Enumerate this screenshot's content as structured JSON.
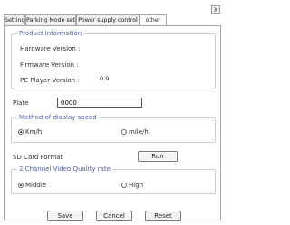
{
  "window": {
    "close_label": "X"
  },
  "tabs": [
    {
      "label": "Setting",
      "active": false
    },
    {
      "label": "Parking Mode set",
      "active": false
    },
    {
      "label": "Power supply control",
      "active": false
    },
    {
      "label": "other",
      "active": true
    }
  ],
  "product_info": {
    "title": "Product information",
    "hardware_label": "Hardware Version :",
    "hardware_value": "",
    "firmware_label": "Firmware Version :",
    "firmware_value": "",
    "pc_player_label": "PC Player Version :",
    "pc_player_value": "0.9"
  },
  "plate": {
    "label": "Plate",
    "value": "0000"
  },
  "speed": {
    "title": "Method of display speed",
    "options": [
      {
        "label": "Km/h",
        "selected": true
      },
      {
        "label": "mile/h",
        "selected": false
      }
    ]
  },
  "sd_format": {
    "label": "SD Card Format",
    "button_label": "Run"
  },
  "video_quality": {
    "title": "2 Channel Video Quality rate",
    "options": [
      {
        "label": "Middle",
        "selected": true
      },
      {
        "label": "High",
        "selected": false
      }
    ]
  },
  "footer": {
    "save_label": "Save",
    "cancel_label": "Cancel",
    "reset_label": "Reset"
  }
}
